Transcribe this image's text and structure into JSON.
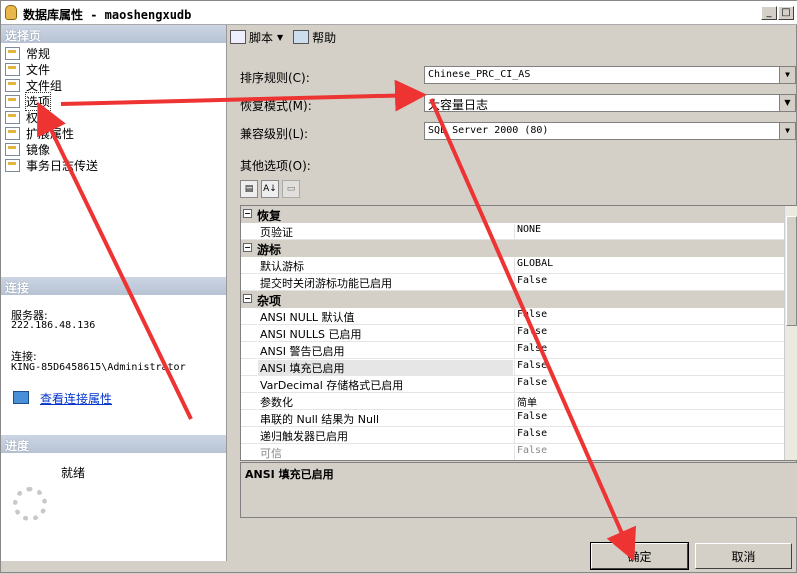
{
  "window": {
    "title": "数据库属性 - maoshengxudb",
    "min": "_",
    "max": "□",
    "close": "✕"
  },
  "left": {
    "select_page_header": "选择页",
    "nav_items": [
      {
        "label": "常规"
      },
      {
        "label": "文件"
      },
      {
        "label": "文件组"
      },
      {
        "label": "选项"
      },
      {
        "label": "权限"
      },
      {
        "label": "扩展属性"
      },
      {
        "label": "镜像"
      },
      {
        "label": "事务日志传送"
      }
    ],
    "selected_index": 3,
    "connection_header": "连接",
    "server_label": "服务器:",
    "server_value": "222.186.48.136",
    "connection_label": "连接:",
    "connection_value": "KING-85D6458615\\Administrator",
    "view_conn_link": "查看连接属性",
    "progress_header": "进度",
    "progress_status": "就绪"
  },
  "toolbar": {
    "script_label": "脚本",
    "help_label": "帮助"
  },
  "form": {
    "collation_label": "排序规则(C):",
    "collation_value": "Chinese_PRC_CI_AS",
    "recovery_label": "恢复模式(M):",
    "recovery_value": "大容量日志",
    "compat_label": "兼容级别(L):",
    "compat_value": "SQL Server 2000 (80)",
    "other_label": "其他选项(O):"
  },
  "grid": {
    "categories": [
      {
        "name": "恢复",
        "rows": [
          {
            "name": "页验证",
            "value": "NONE"
          }
        ]
      },
      {
        "name": "游标",
        "rows": [
          {
            "name": "默认游标",
            "value": "GLOBAL"
          },
          {
            "name": "提交时关闭游标功能已启用",
            "value": "False"
          }
        ]
      },
      {
        "name": "杂项",
        "rows": [
          {
            "name": "ANSI NULL 默认值",
            "value": "False"
          },
          {
            "name": "ANSI NULLS 已启用",
            "value": "False"
          },
          {
            "name": "ANSI 警告已启用",
            "value": "False"
          },
          {
            "name": "ANSI 填充已启用",
            "value": "False"
          },
          {
            "name": "VarDecimal 存储格式已启用",
            "value": "False"
          },
          {
            "name": "参数化",
            "value": "简单"
          },
          {
            "name": "串联的 Null 结果为 Null",
            "value": "False"
          },
          {
            "name": "递归触发器已启用",
            "value": "False"
          },
          {
            "name": "可信",
            "value": "False"
          }
        ]
      }
    ],
    "description": "ANSI 填充已启用"
  },
  "buttons": {
    "ok": "确定",
    "cancel": "取消"
  },
  "annotation_color": "#ee3333"
}
